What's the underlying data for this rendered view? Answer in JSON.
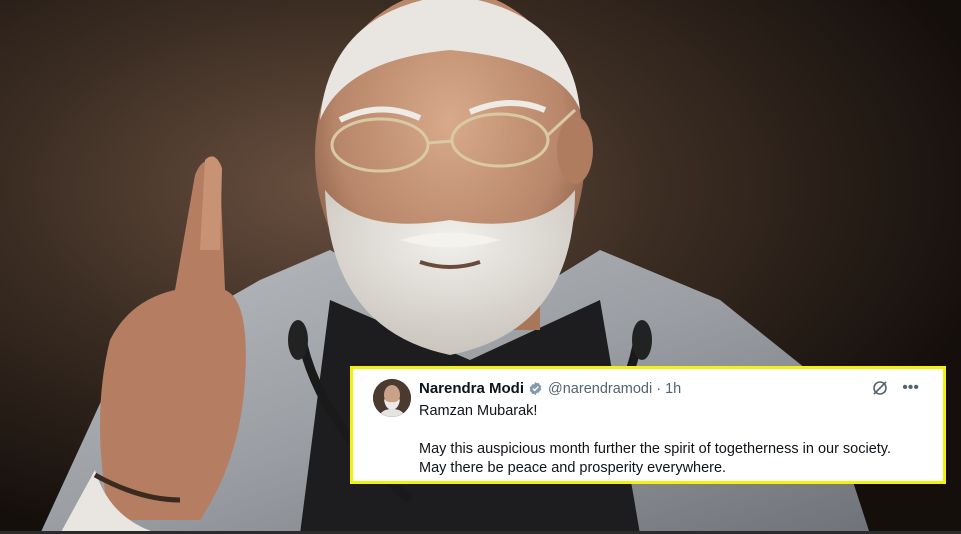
{
  "tweet": {
    "author_name": "Narendra Modi",
    "handle": "@narendramodi · 1h",
    "greeting": "Ramzan Mubarak!",
    "line_1": "May this auspicious month further the spirit of togetherness in our society.",
    "line_2": "May there be peace and prosperity everywhere.",
    "icons": [
      "verified-badge-icon",
      "grok-icon",
      "more-icon"
    ],
    "colors": {
      "card_border": "#f2f20c",
      "text": "#0f1419",
      "muted": "#536471"
    }
  }
}
